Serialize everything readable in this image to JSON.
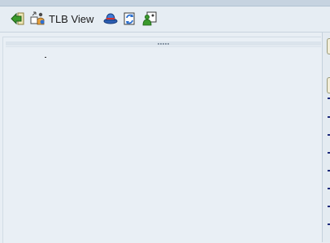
{
  "toolbar": {
    "back_icon": "back-arrow-icon",
    "tlb_view_icon": "tlb-view-icon",
    "tlb_view_label": "TLB View",
    "hat_icon": "hat-icon",
    "refresh_icon": "refresh-icon",
    "user_icon": "user-icon"
  },
  "colors": {
    "background": "#e8eef4",
    "toolbar": "#e6edf3",
    "accent_green": "#3a9a2c"
  }
}
